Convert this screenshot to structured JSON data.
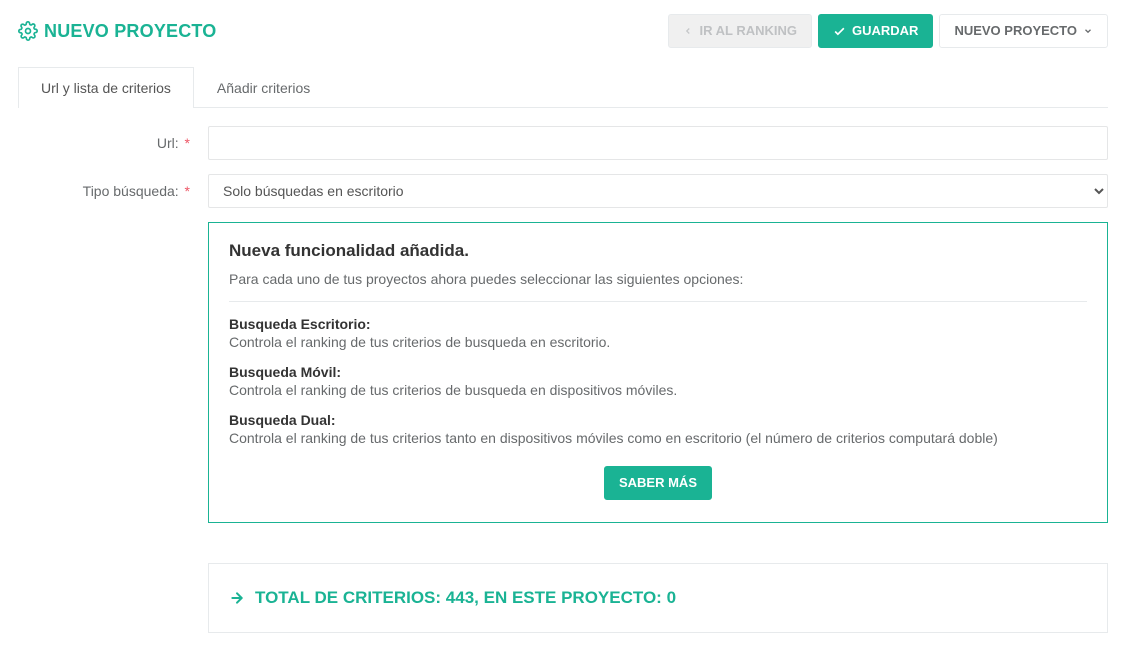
{
  "header": {
    "title": "NUEVO PROYECTO",
    "actions": {
      "go_ranking": "IR AL RANKING",
      "save": "GUARDAR",
      "new_project": "NUEVO PROYECTO"
    }
  },
  "tabs": {
    "url_criteria": "Url y lista de criterios",
    "add_criteria": "Añadir criterios"
  },
  "form": {
    "url_label": "Url:",
    "url_value": "",
    "search_type_label": "Tipo búsqueda:",
    "search_type_value": "Solo búsquedas en escritorio"
  },
  "info": {
    "title": "Nueva funcionalidad añadida.",
    "subtitle": "Para cada uno de tus proyectos ahora puedes seleccionar las siguientes opciones:",
    "features": [
      {
        "title": "Busqueda Escritorio:",
        "desc": "Controla el ranking de tus criterios de busqueda en escritorio."
      },
      {
        "title": "Busqueda Móvil:",
        "desc": "Controla el ranking de tus criterios de busqueda en dispositivos móviles."
      },
      {
        "title": "Busqueda Dual:",
        "desc": "Controla el ranking de tus criterios tanto en dispositivos móviles como en escritorio (el número de criterios computará doble)"
      }
    ],
    "learn_more": "SABER MÁS"
  },
  "totals": {
    "total_criteria": 443,
    "project_criteria": 0,
    "line_prefix": "TOTAL DE CRITERIOS: ",
    "line_middle": ", EN ESTE PROYECTO: "
  },
  "colors": {
    "accent": "#1ab394",
    "danger": "#ed5565"
  }
}
